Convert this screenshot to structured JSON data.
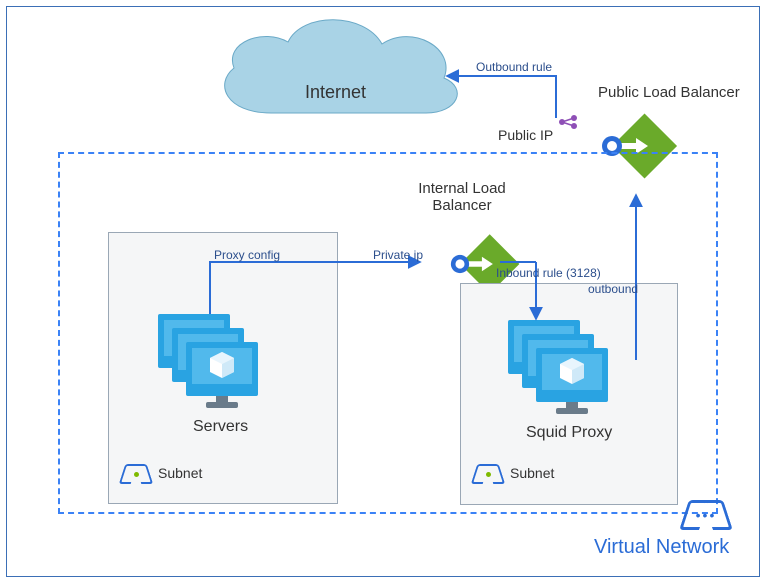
{
  "colors": {
    "azure_blue": "#2b6cd6",
    "lb_green": "#6aaa2a",
    "cloud": "#8fc6df",
    "vm_blue": "#29a3e2",
    "gray_border": "#9aa7b5",
    "text_dark": "#333333",
    "text_blue": "#2b4e8c"
  },
  "outer": {},
  "cloud": {
    "label": "Internet"
  },
  "public_lb": {
    "label": "Public Load Balancer",
    "public_ip_label": "Public IP"
  },
  "internal_lb": {
    "label": "Internal Load\nBalancer",
    "private_ip_label": "Private ip"
  },
  "arrows": {
    "outbound_rule": "Outbound rule",
    "inbound_rule": "Inbound rule (3128)",
    "outbound": "outbound",
    "proxy_config": "Proxy config"
  },
  "vnet": {
    "label": "Virtual Network"
  },
  "subnets": {
    "left": {
      "group_label": "Servers",
      "subnet_label": "Subnet"
    },
    "right": {
      "group_label": "Squid Proxy",
      "subnet_label": "Subnet"
    }
  }
}
